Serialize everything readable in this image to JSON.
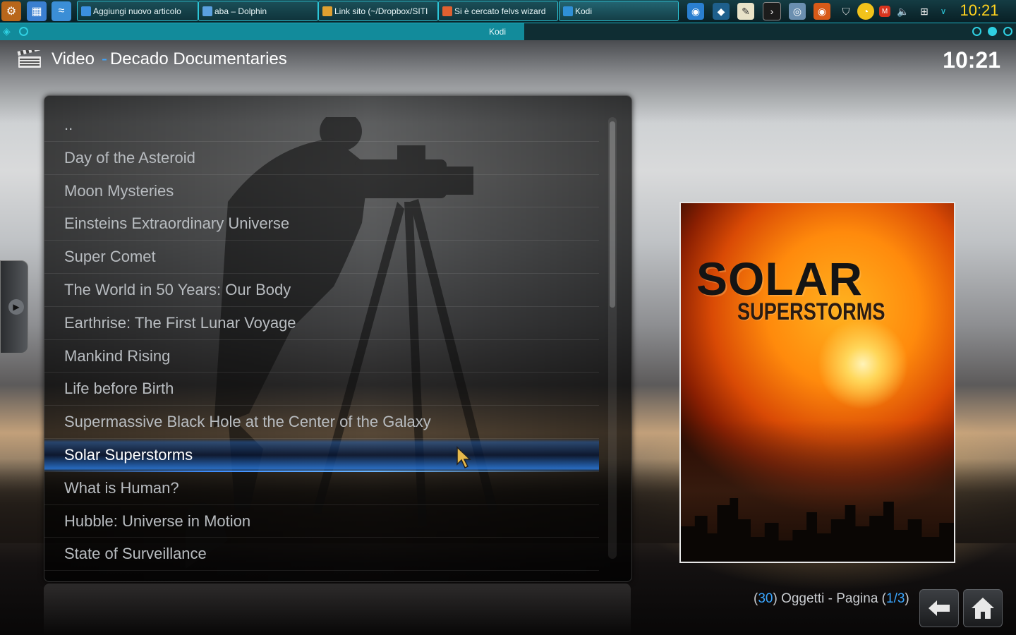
{
  "taskbar": {
    "launchers": [
      {
        "name": "app-menu-icon",
        "color": "#d47b1e",
        "glyph": "⚙"
      },
      {
        "name": "desktop-icon",
        "color": "#3a7fd0",
        "glyph": "▦"
      },
      {
        "name": "dolphin-launcher-icon",
        "color": "#4a9bd8",
        "glyph": "≈"
      }
    ],
    "tasks": [
      {
        "label": "Aggiungi nuovo articolo",
        "icon_color": "#3b8fe0"
      },
      {
        "label": "aba – Dolphin",
        "icon_color": "#5aa0e0"
      },
      {
        "label": "Link sito (~/Dropbox/SITI",
        "icon_color": "#e0a030"
      },
      {
        "label": "Si è cercato felvs wizard",
        "icon_color": "#e06030"
      },
      {
        "label": "Kodi",
        "icon_color": "#2f8fd6"
      }
    ],
    "clock": "10:21"
  },
  "window": {
    "title": "Kodi"
  },
  "header": {
    "section": "Video",
    "separator": "-",
    "folder": "Decado Documentaries",
    "clock": "10:21"
  },
  "list": {
    "items": [
      "..",
      "Day of the Asteroid",
      "Moon Mysteries",
      "Einsteins Extraordinary Universe",
      "Super Comet",
      "The World in 50 Years: Our Body",
      "Earthrise: The First Lunar Voyage",
      "Mankind Rising",
      "Life before Birth",
      "Supermassive Black Hole at the Center of the Galaxy",
      "Solar Superstorms",
      "What is Human?",
      "Hubble: Universe in Motion",
      "State of Surveillance"
    ],
    "selected_index": 10,
    "scroll_fraction": 0.43
  },
  "poster": {
    "line1": "SOLAR",
    "line2": "SUPERSTORMS"
  },
  "footer": {
    "open_paren": "(",
    "count": "30",
    "count_text": ") Oggetti - Pagina (",
    "page": "1/3",
    "close_paren": ")"
  },
  "colors": {
    "accent": "#3aa6ff",
    "tray_clock": "#ffd21e",
    "taskbar_border": "#2cc6d8"
  }
}
